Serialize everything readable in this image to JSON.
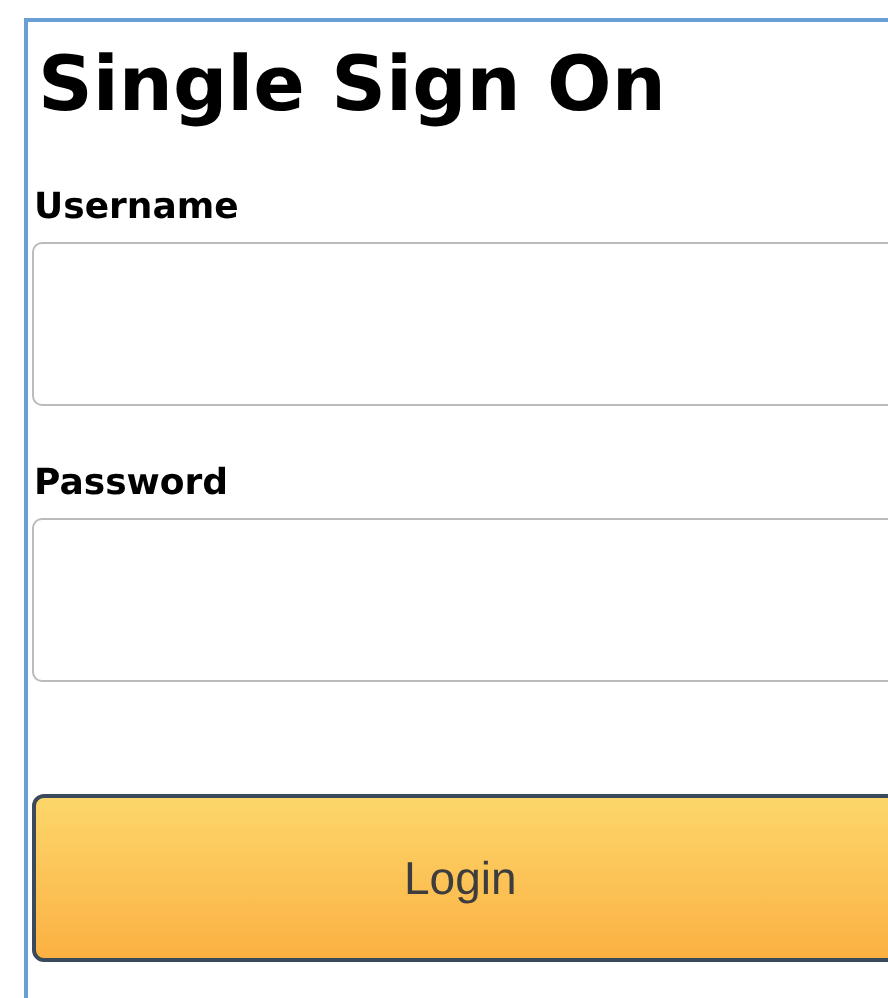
{
  "title": "Single Sign On",
  "fields": [
    {
      "label": "Username"
    },
    {
      "label": "Password"
    }
  ],
  "button": {
    "label": "Login"
  }
}
